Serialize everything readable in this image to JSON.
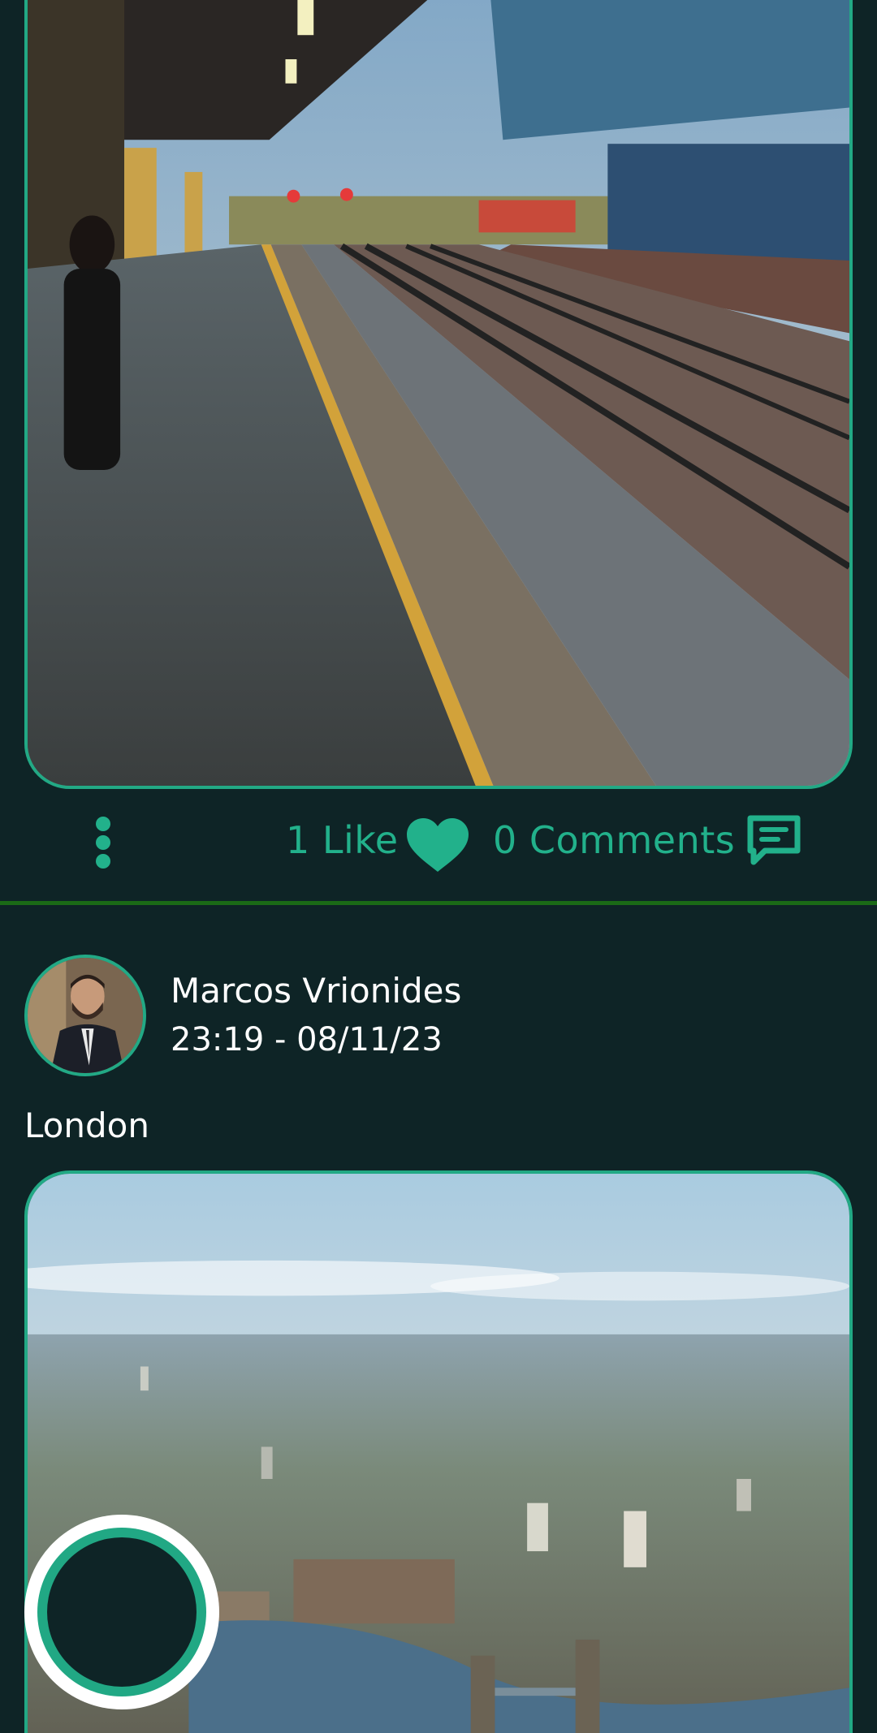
{
  "colors": {
    "background": "#0e2426",
    "accent": "#22b18b",
    "divider": "#1a6a16",
    "text": "#ffffff"
  },
  "posts": [
    {
      "image": "railway-station-platform-photo",
      "likes_label": "1 Like",
      "comments_label": "0 Comments"
    },
    {
      "author": "Marcos Vrionides",
      "timestamp": "23:19 - 08/11/23",
      "caption": "London",
      "avatar": "user-avatar-photo",
      "image": "london-skyline-photo"
    }
  ],
  "icons": {
    "more": "more-vertical-icon",
    "like": "heart-icon",
    "comment": "comment-icon",
    "record": "record-button"
  }
}
